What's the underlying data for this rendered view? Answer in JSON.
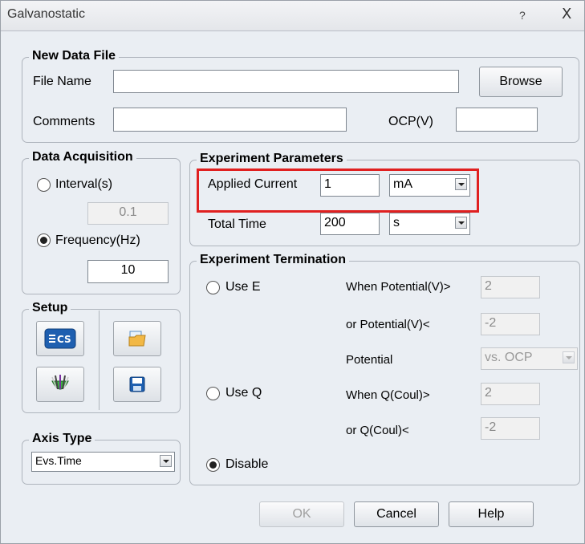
{
  "window": {
    "title": "Galvanostatic",
    "help_symbol": "?",
    "close_symbol": "X"
  },
  "new_data_file": {
    "group_title": "New Data File",
    "file_name_label": "File Name",
    "file_name_value": "",
    "browse_label": "Browse",
    "comments_label": "Comments",
    "comments_value": "",
    "ocp_label": "OCP(V)",
    "ocp_value": ""
  },
  "data_acquisition": {
    "group_title": "Data Acquisition",
    "interval_label": "Interval(s)",
    "interval_value": "0.1",
    "interval_selected": false,
    "frequency_label": "Frequency(Hz)",
    "frequency_value": "10",
    "frequency_selected": true
  },
  "setup": {
    "group_title": "Setup",
    "buttons": [
      {
        "icon": "cs-instrument-icon"
      },
      {
        "icon": "open-folder-icon"
      },
      {
        "icon": "electrode-icon"
      },
      {
        "icon": "save-disk-icon"
      }
    ]
  },
  "axis_type": {
    "group_title": "Axis Type",
    "value": "Evs.Time"
  },
  "experiment_parameters": {
    "group_title": "Experiment Parameters",
    "applied_current_label": "Applied Current",
    "applied_current_value": "1",
    "applied_current_unit": "mA",
    "total_time_label": "Total Time",
    "total_time_value": "200",
    "total_time_unit": "s"
  },
  "experiment_termination": {
    "group_title": "Experiment Termination",
    "use_e_label": "Use E",
    "when_potential_label": "When Potential(V)>",
    "when_potential_value": "2",
    "or_potential_label": "or Potential(V)<",
    "or_potential_value": "-2",
    "potential_label": "Potential",
    "potential_value": "vs. OCP",
    "use_q_label": "Use Q",
    "when_q_label": "When Q(Coul)>",
    "when_q_value": "2",
    "or_q_label": "or Q(Coul)<",
    "or_q_value": "-2",
    "disable_label": "Disable",
    "selected": "Disable"
  },
  "footer": {
    "ok_label": "OK",
    "cancel_label": "Cancel",
    "help_label": "Help"
  },
  "colors": {
    "highlight": "#e02020",
    "window_bg": "#eaeef3"
  }
}
